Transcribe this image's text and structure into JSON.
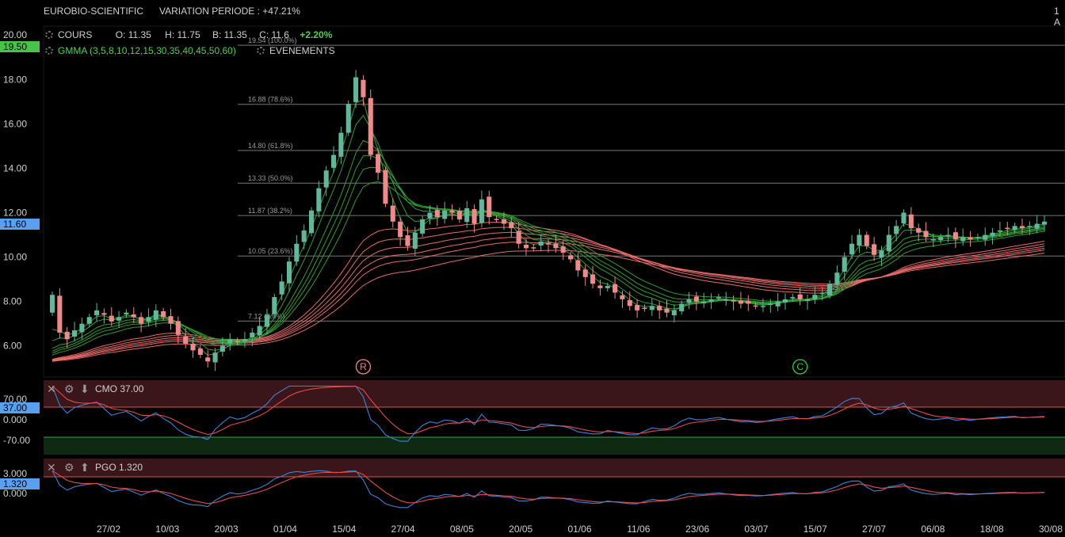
{
  "header": {
    "symbol": "EUROBIO-SCIENTIFIC",
    "variation": "VARIATION PERIODE : +47.21%",
    "corner": "1 A"
  },
  "legend": {
    "cours_label": "COURS",
    "open": "O: 11.35",
    "high": "H: 11.75",
    "low": "B: 11.35",
    "close": "C: 11.6",
    "change": "+2.20%",
    "gmma_label": "GMMA (3,5,8,10,12,15,30,35,40,45,50,60)",
    "events_label": "EVENEMENTS"
  },
  "price_axis": {
    "labels": [
      "20.00",
      "18.00",
      "16.00",
      "14.00",
      "12.00",
      "10.00",
      "8.00",
      "6.00"
    ],
    "high_tag": "19.50",
    "last_tag": "11.60"
  },
  "fib_levels": [
    {
      "value": 19.54,
      "label": "19.54  (100.0%)"
    },
    {
      "value": 16.88,
      "label": "16.88  (78.6%)"
    },
    {
      "value": 14.8,
      "label": "14.80  (61.8%)"
    },
    {
      "value": 13.33,
      "label": "13.33  (50.0%)"
    },
    {
      "value": 11.87,
      "label": "11.87  (38.2%)"
    },
    {
      "value": 10.05,
      "label": "10.05  (23.6%)"
    },
    {
      "value": 7.12,
      "label": "7.12  (0.0%)"
    }
  ],
  "events": [
    {
      "letter": "R",
      "date": "15/04",
      "color": "#ff8080"
    },
    {
      "letter": "C",
      "date": "20/07",
      "color": "#33cc33"
    }
  ],
  "cmo": {
    "name": "CMO",
    "value": "37.00",
    "axis_labels": [
      "70.00",
      "0.000",
      "-70.00"
    ],
    "tag": "37.00"
  },
  "pgo": {
    "name": "PGO",
    "value": "1.320",
    "axis_labels": [
      "3.000",
      "0.000"
    ],
    "tag": "1.320"
  },
  "time_axis": [
    "27/02",
    "10/03",
    "20/03",
    "01/04",
    "15/04",
    "27/04",
    "08/05",
    "20/05",
    "01/06",
    "11/06",
    "23/06",
    "03/07",
    "15/07",
    "27/07",
    "06/08",
    "18/08",
    "30/08"
  ],
  "colors": {
    "up_candle": "#5fb89a",
    "down_candle": "#f08a8a",
    "short_gmma": "#2e9e2e",
    "long_gmma": "#e86a6a",
    "osc_blue": "#3b83d9",
    "osc_red": "#e84a4a",
    "tag_blue": "#5aa0f0",
    "tag_green": "#49c24a"
  },
  "chart_data": {
    "type": "candlestick",
    "ylim": [
      4.6,
      20.4
    ],
    "close": [
      8.3,
      6.6,
      6.3,
      6.7,
      7.0,
      7.3,
      7.6,
      7.4,
      7.1,
      7.3,
      7.5,
      7.3,
      7.0,
      7.3,
      7.6,
      7.3,
      7.0,
      6.5,
      6.1,
      5.8,
      5.6,
      5.3,
      5.7,
      6.0,
      6.3,
      6.2,
      6.3,
      6.6,
      6.9,
      7.4,
      8.2,
      8.9,
      9.8,
      10.6,
      11.2,
      12.1,
      13.1,
      13.9,
      14.6,
      15.6,
      16.9,
      18.1,
      17.2,
      14.6,
      13.8,
      12.4,
      11.6,
      10.9,
      10.5,
      11.1,
      11.7,
      12.0,
      11.8,
      12.1,
      12.0,
      11.7,
      12.2,
      11.5,
      12.6,
      11.8,
      11.7,
      11.5,
      11.3,
      10.6,
      10.4,
      10.4,
      10.7,
      10.6,
      10.4,
      10.2,
      9.9,
      9.4,
      9.1,
      8.8,
      8.6,
      8.7,
      8.4,
      8.1,
      7.8,
      7.6,
      7.7,
      7.8,
      7.6,
      7.5,
      7.6,
      7.9,
      8.1,
      8.0,
      8.0,
      8.1,
      8.2,
      8.1,
      8.0,
      7.9,
      7.9,
      7.8,
      7.8,
      7.9,
      8.0,
      8.1,
      8.2,
      8.1,
      8.1,
      8.3,
      8.4,
      8.8,
      9.3,
      10.0,
      10.6,
      11.0,
      10.5,
      10.1,
      10.3,
      11.0,
      11.4,
      12.0,
      11.3,
      11.1,
      10.9,
      10.8,
      10.9,
      11.0,
      10.8,
      10.9,
      10.8,
      10.9,
      11.0,
      11.1,
      11.2,
      11.3,
      11.4,
      11.3,
      11.4,
      11.5,
      11.6
    ],
    "time_labels": [
      "27/02",
      "10/03",
      "20/03",
      "01/04",
      "15/04",
      "27/04",
      "08/05",
      "20/05",
      "01/06",
      "11/06",
      "23/06",
      "03/07",
      "15/07",
      "27/07",
      "06/08",
      "18/08",
      "30/08"
    ]
  }
}
